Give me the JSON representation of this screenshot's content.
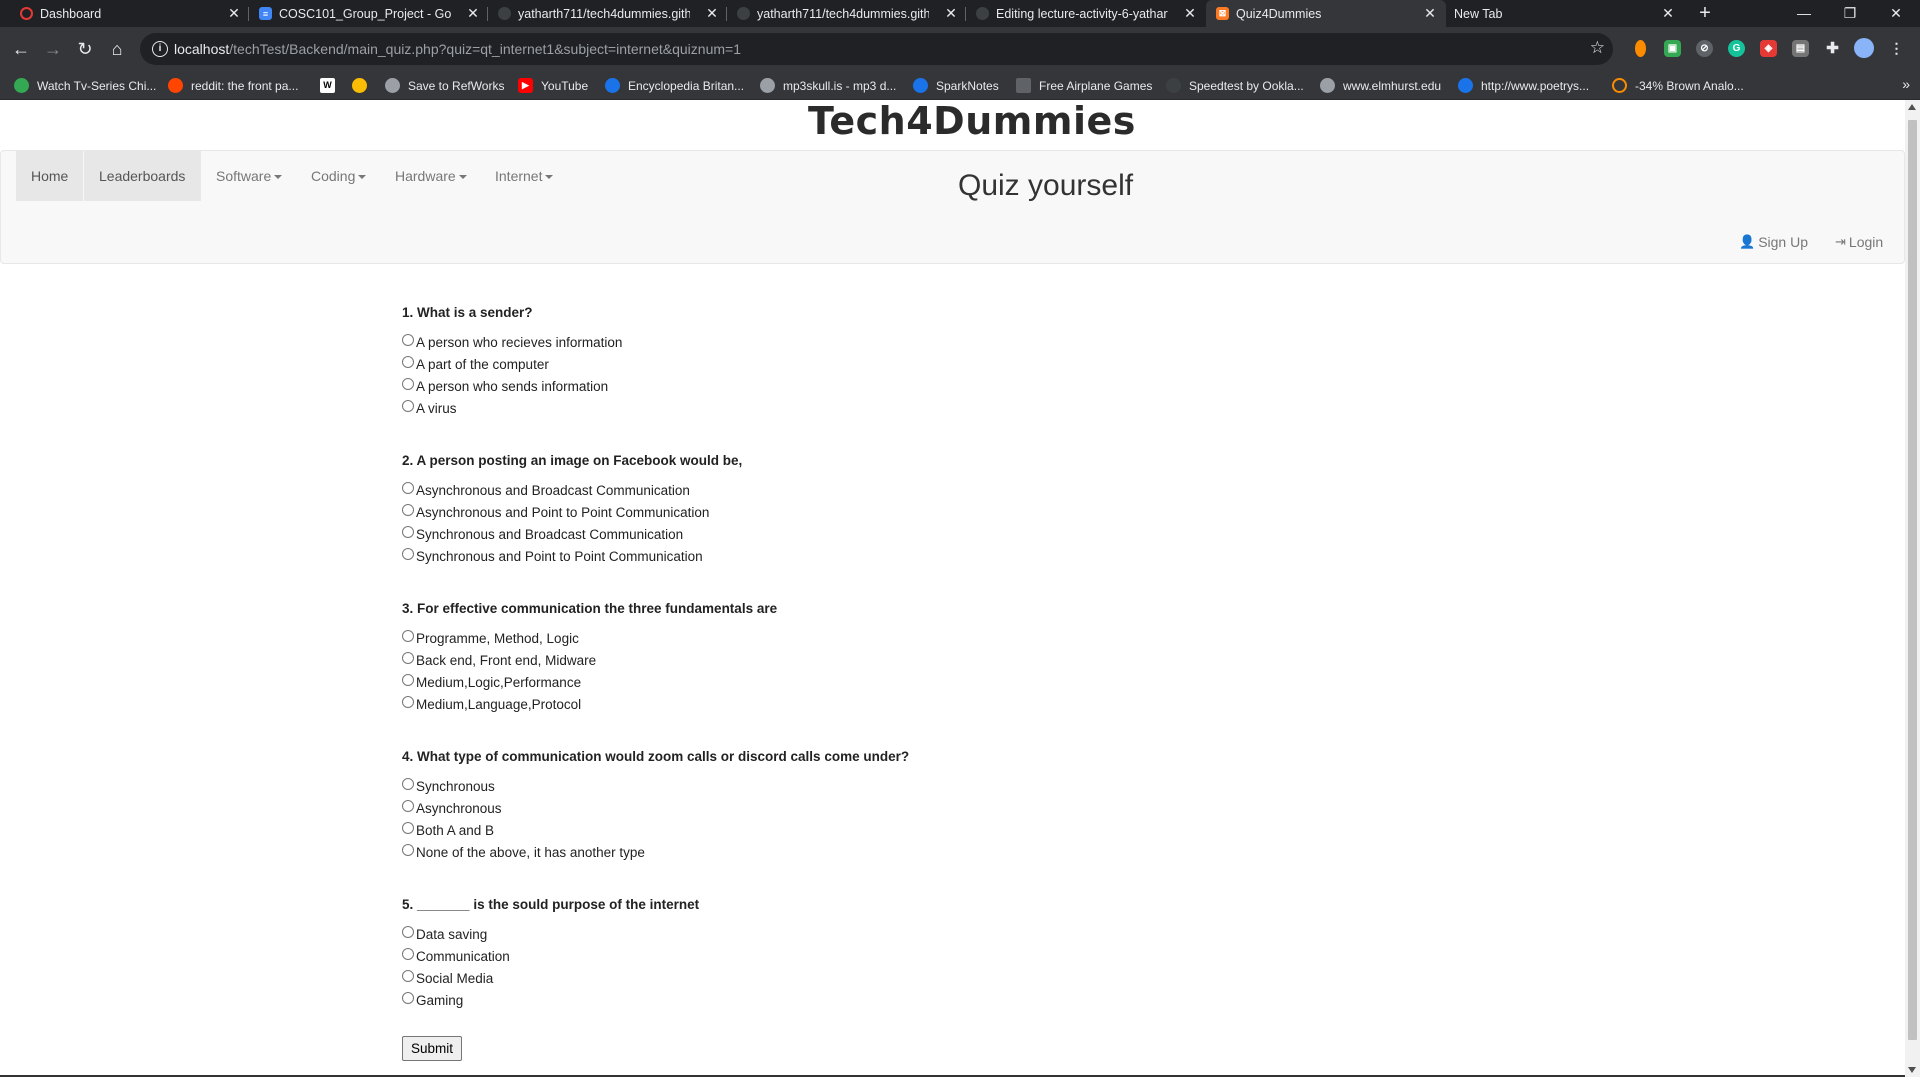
{
  "browser": {
    "tabs": [
      {
        "title": "Dashboard",
        "icon": "dashboard-ring-icon",
        "color": "#e53935"
      },
      {
        "title": "COSC101_Group_Project - Googl",
        "icon": "google-docs-icon",
        "color": "#4285f4"
      },
      {
        "title": "yatharth711/tech4dummies.gith",
        "icon": "github-icon",
        "color": "#3c4043"
      },
      {
        "title": "yatharth711/tech4dummies.githu",
        "icon": "github-icon",
        "color": "#3c4043"
      },
      {
        "title": "Editing lecture-activity-6-yathart",
        "icon": "github-icon",
        "color": "#3c4043"
      },
      {
        "title": "Quiz4Dummies",
        "icon": "xampp-icon",
        "color": "#fb7a24"
      },
      {
        "title": "New Tab",
        "icon": "",
        "color": ""
      }
    ],
    "address": {
      "host": "localhost",
      "path": "/techTest/Backend/main_quiz.php?quiz=qt_internet1&subject=internet&quiznum=1"
    },
    "bookmarks": [
      {
        "label": "Watch Tv-Series Chi...",
        "color": "#34a853"
      },
      {
        "label": "reddit: the front pa...",
        "color": "#ff4500"
      },
      {
        "label": "",
        "color": "#ffffff"
      },
      {
        "label": "",
        "color": "#fbbc04"
      },
      {
        "label": "Save to RefWorks",
        "color": "#9aa0a6"
      },
      {
        "label": "YouTube",
        "color": "#ff0000"
      },
      {
        "label": "Encyclopedia Britan...",
        "color": "#1a73e8"
      },
      {
        "label": "mp3skull.is - mp3 d...",
        "color": "#9aa0a6"
      },
      {
        "label": "SparkNotes",
        "color": "#1a73e8"
      },
      {
        "label": "Free Airplane Games",
        "color": "#5f6368"
      },
      {
        "label": "Speedtest by Ookla...",
        "color": "#3c4043"
      },
      {
        "label": "www.elmhurst.edu",
        "color": "#9aa0a6"
      },
      {
        "label": "http://www.poetrys...",
        "color": "#1a73e8"
      },
      {
        "label": "-34% Brown Analo...",
        "color": "#fb8c00"
      }
    ]
  },
  "site": {
    "title": "Tech4Dummies",
    "nav": {
      "home": "Home",
      "leaderboards": "Leaderboards",
      "software": "Software",
      "coding": "Coding",
      "hardware": "Hardware",
      "internet": "Internet"
    },
    "heading": "Quiz yourself",
    "signup": "Sign Up",
    "login": "Login"
  },
  "quiz": {
    "questions": [
      {
        "text": "1. What is a sender?",
        "options": [
          "A person who recieves information",
          "A part of the computer",
          "A person who sends information",
          "A virus"
        ]
      },
      {
        "text": "2. A person posting an image on Facebook would be,",
        "options": [
          "Asynchronous and Broadcast Communication",
          "Asynchronous and Point to Point Communication",
          "Synchronous and Broadcast Communication",
          "Synchronous and Point to Point Communication"
        ]
      },
      {
        "text": "3. For effective communication the three fundamentals are",
        "options": [
          "Programme, Method, Logic",
          "Back end, Front end, Midware",
          "Medium,Logic,Performance",
          "Medium,Language,Protocol"
        ]
      },
      {
        "text": "4. What type of communication would zoom calls or discord calls come under?",
        "options": [
          "Synchronous",
          "Asynchronous",
          "Both A and B",
          "None of the above, it has another type"
        ]
      },
      {
        "text": "5. _______ is the sould purpose of the internet",
        "options": [
          "Data saving",
          "Communication",
          "Social Media",
          "Gaming"
        ]
      }
    ],
    "submit": "Submit"
  }
}
